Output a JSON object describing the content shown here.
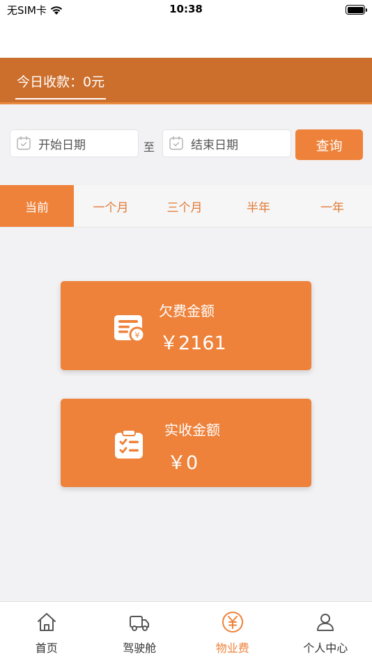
{
  "status_bar": {
    "carrier": "无SIM卡",
    "time": "10:38"
  },
  "banner": {
    "today_income": "今日收款：0元"
  },
  "filter": {
    "start_date_placeholder": "开始日期",
    "to_label": "至",
    "end_date_placeholder": "结束日期",
    "query_label": "查询"
  },
  "tabs": [
    {
      "label": "当前",
      "active": true
    },
    {
      "label": "一个月",
      "active": false
    },
    {
      "label": "三个月",
      "active": false
    },
    {
      "label": "半年",
      "active": false
    },
    {
      "label": "一年",
      "active": false
    }
  ],
  "cards": {
    "owed": {
      "title": "欠费金额",
      "amount": "￥2161",
      "icon": "bill-yuan-icon"
    },
    "received": {
      "title": "实收金额",
      "amount": "￥0",
      "icon": "clipboard-checklist-icon"
    }
  },
  "tabbar": [
    {
      "label": "首页",
      "icon": "home-icon",
      "active": false
    },
    {
      "label": "驾驶舱",
      "icon": "truck-icon",
      "active": false
    },
    {
      "label": "物业费",
      "icon": "yuan-circle-icon",
      "active": true
    },
    {
      "label": "个人中心",
      "icon": "person-icon",
      "active": false
    }
  ],
  "colors": {
    "accent": "#ee823a",
    "banner": "#cc6f2d",
    "background": "#f2f2f4"
  }
}
